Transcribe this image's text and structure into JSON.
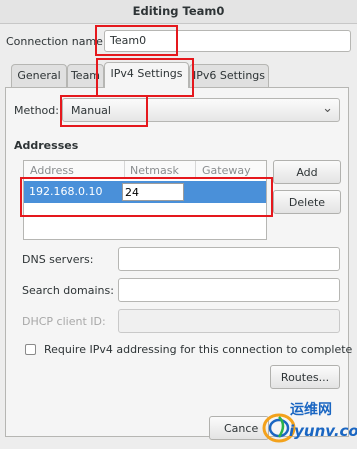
{
  "window": {
    "title": "Editing Team0"
  },
  "connection_name": {
    "label": "Connection name:",
    "value": "Team0"
  },
  "tabs": [
    {
      "label": "General"
    },
    {
      "label": "Team"
    },
    {
      "label": "IPv4 Settings"
    },
    {
      "label": "IPv6 Settings"
    }
  ],
  "method": {
    "label": "Method:",
    "value": "Manual"
  },
  "addresses": {
    "title": "Addresses",
    "columns": [
      "Address",
      "Netmask",
      "Gateway"
    ],
    "rows": [
      {
        "address": "192.168.0.10",
        "netmask": "24",
        "gateway": ""
      }
    ],
    "add_label": "Add",
    "delete_label": "Delete"
  },
  "dns_servers": {
    "label": "DNS servers:",
    "value": ""
  },
  "search_domains": {
    "label": "Search domains:",
    "value": ""
  },
  "dhcp_client_id": {
    "label": "DHCP client ID:",
    "value": ""
  },
  "require_ipv4": {
    "label": "Require IPv4 addressing for this connection to complete",
    "checked": false
  },
  "routes_label": "Routes...",
  "footer": {
    "cancel_label": "Cance"
  },
  "watermark": {
    "text": "运维网",
    "url": "iyunv.com"
  },
  "colors": {
    "highlight_row": "#4a90d9",
    "annotation": "#e5181d",
    "watermark_blue": "#1a66c2"
  }
}
